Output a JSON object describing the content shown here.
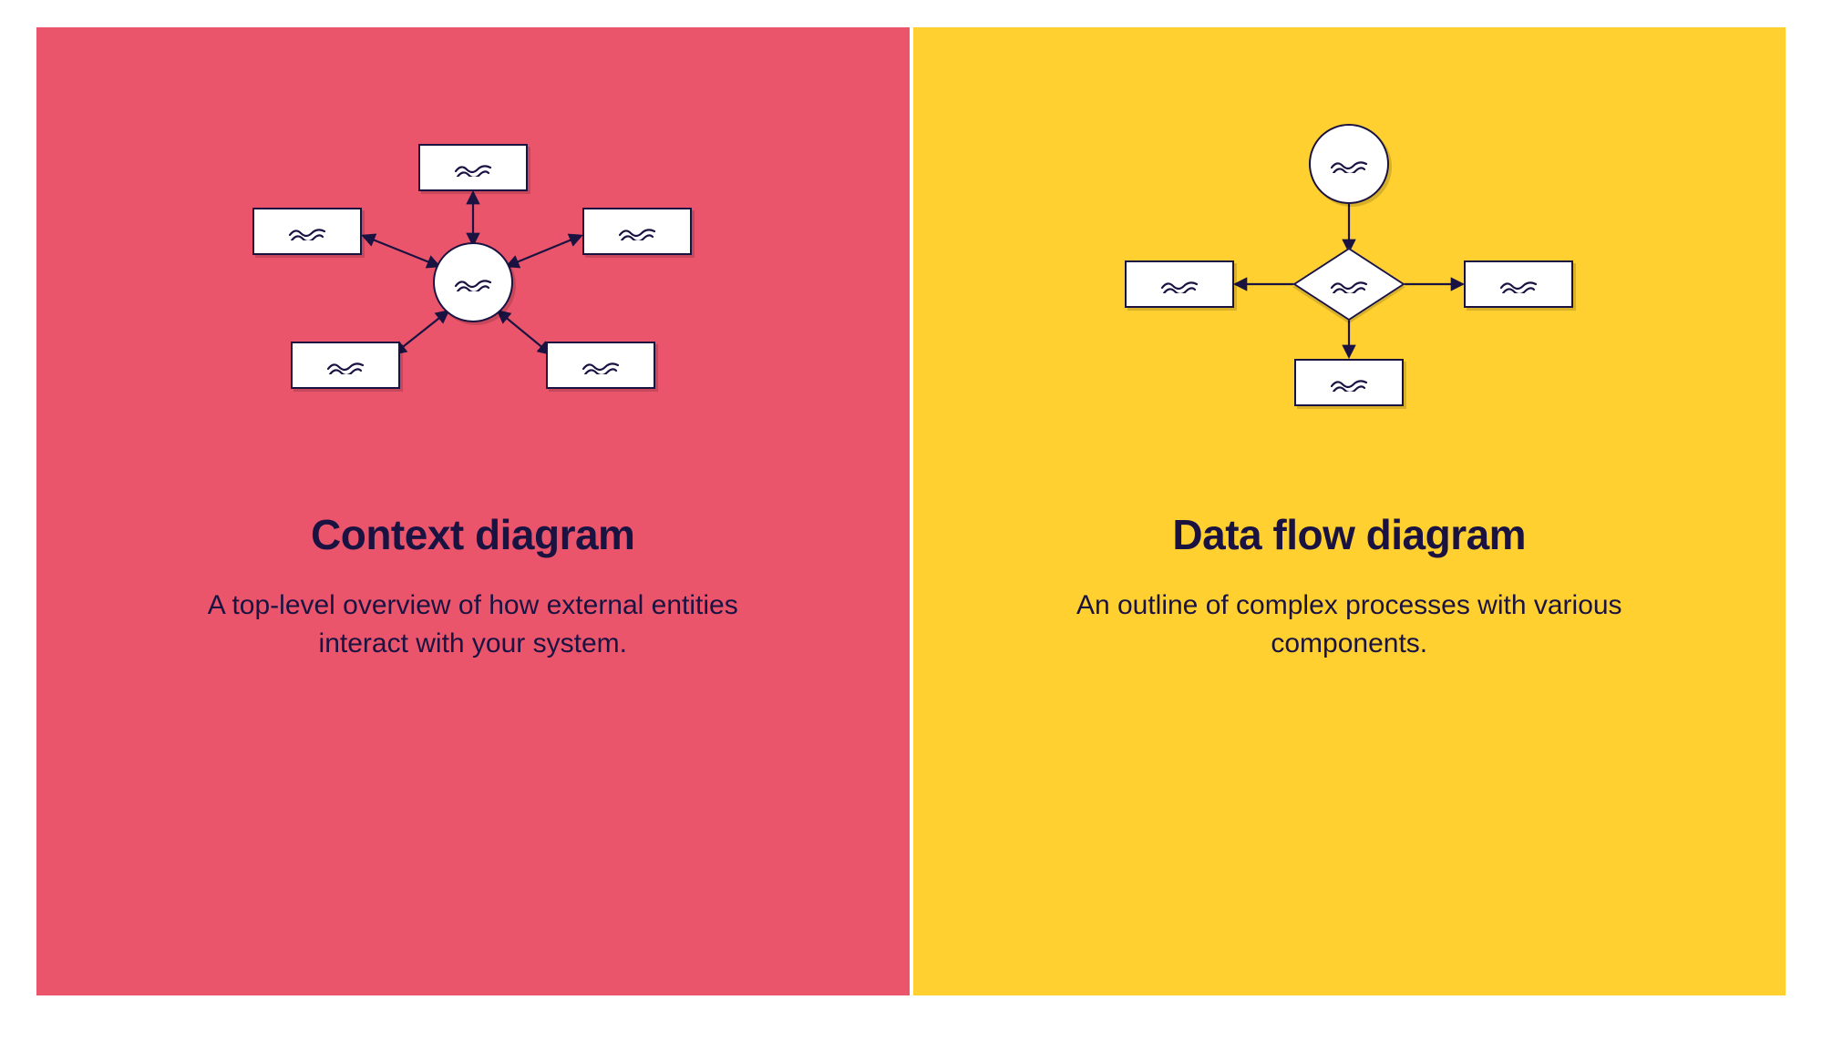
{
  "panels": {
    "left": {
      "bg_color": "#eb556b",
      "title": "Context diagram",
      "description": "A top-level overview of how external entities interact with your system.",
      "diagram": {
        "type": "context-diagram",
        "center_shape": "circle",
        "external_shapes": "rectangle",
        "external_count": 5,
        "connectors": "bidirectional-arrows"
      }
    },
    "right": {
      "bg_color": "#ffd02f",
      "title": "Data flow diagram",
      "description": "An outline of complex processes with various components.",
      "diagram": {
        "type": "data-flow-diagram",
        "nodes": [
          "circle",
          "diamond",
          "rectangle",
          "rectangle",
          "rectangle"
        ],
        "flow": "top-down-with-branches",
        "connectors": "unidirectional-arrows"
      }
    }
  },
  "shape_glyph": "squiggle",
  "stroke_color": "#1a1342"
}
